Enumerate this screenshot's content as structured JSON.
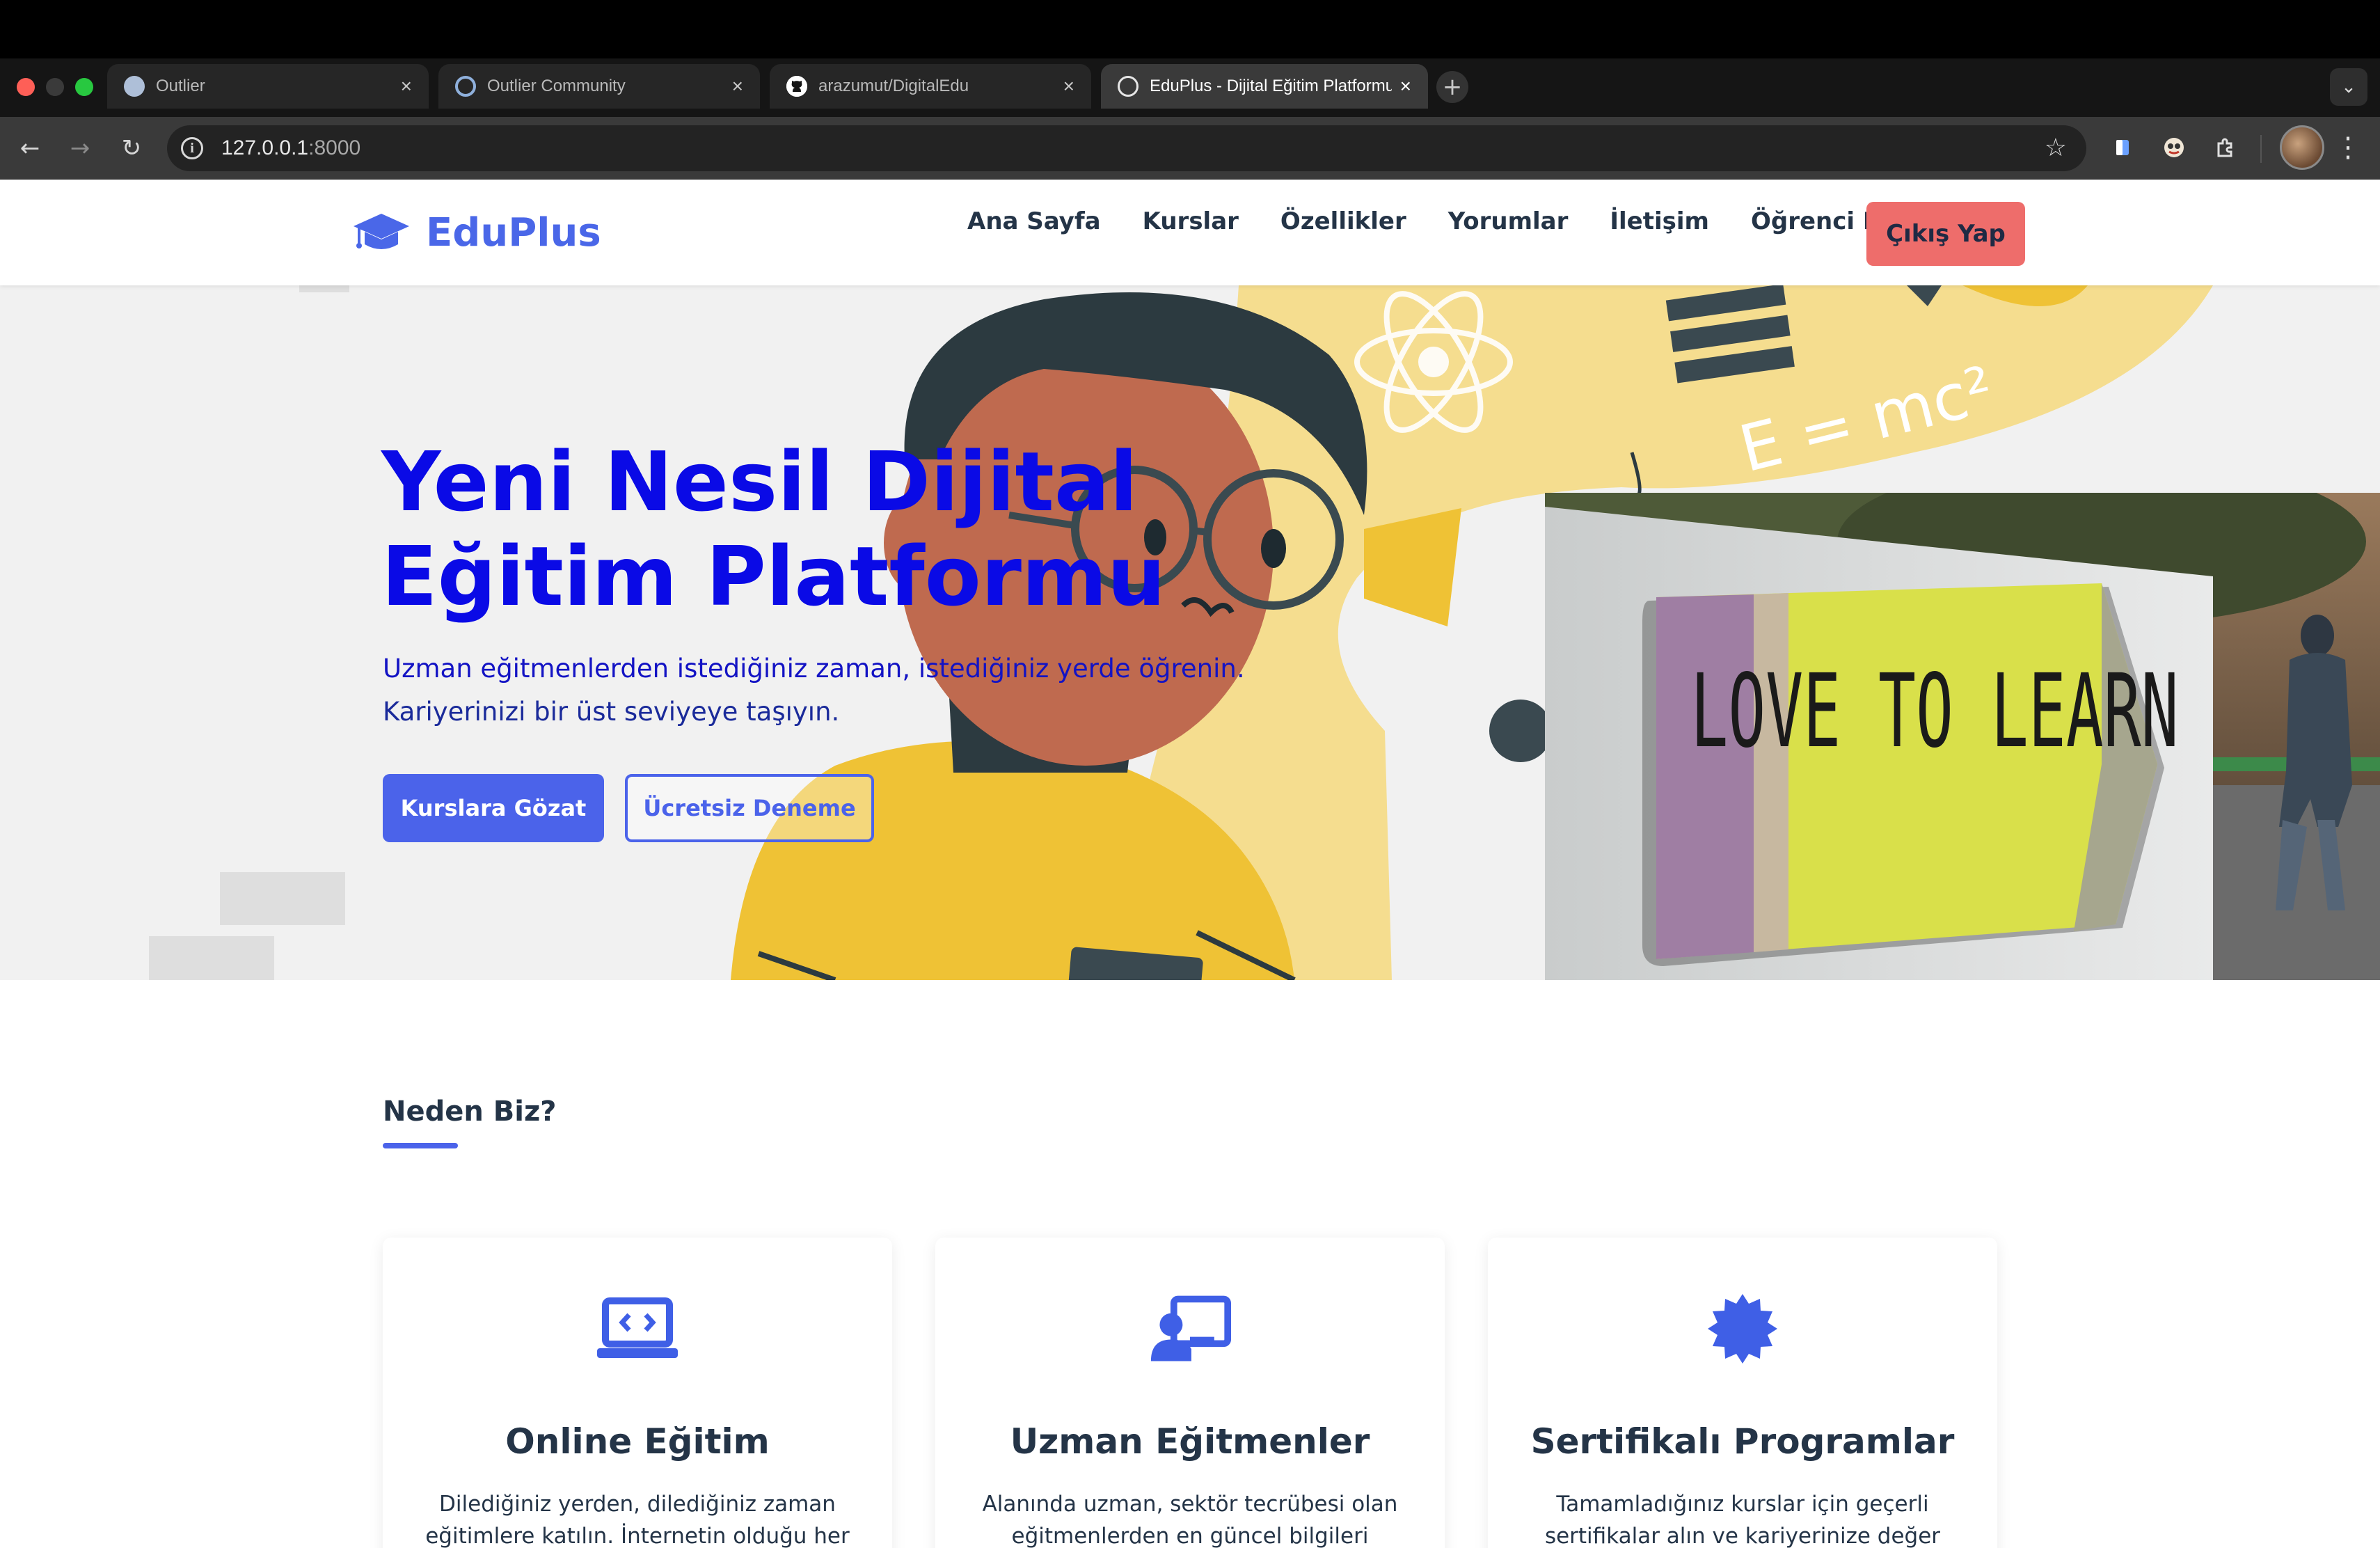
{
  "browser": {
    "tabs": [
      {
        "label": "Outlier",
        "favicon": "outlier-icon"
      },
      {
        "label": "Outlier Community",
        "favicon": "outlier-community-icon"
      },
      {
        "label": "arazumut/DigitalEdu",
        "favicon": "github-icon"
      },
      {
        "label": "EduPlus - Dijital Eğitim Platformu",
        "favicon": "globe-icon",
        "active": true
      }
    ],
    "url_host": "127.0.0.1",
    "url_port": ":8000"
  },
  "header": {
    "brand": "EduPlus",
    "nav": [
      "Ana Sayfa",
      "Kurslar",
      "Özellikler",
      "Yorumlar",
      "İletişim",
      "Öğrenci Paneli"
    ],
    "logout_label": "Çıkış Yap"
  },
  "hero": {
    "title_line1": "Yeni Nesil Dijital",
    "title_line2": "Eğitim Platformu",
    "subtitle_line1": "Uzman eğitmenlerden istediğiniz zaman, istediğiniz yerde öğrenin.",
    "subtitle_line2": "Kariyerinizi bir üst seviyeye taşıyın.",
    "primary_button": "Kurslara Gözat",
    "secondary_button": "Ücretsiz Deneme",
    "illustration_text": "E = mc²",
    "photo_sign_text": "LOVE TO LEARN"
  },
  "why": {
    "title": "Neden Biz?",
    "features": [
      {
        "title": "Online Eğitim",
        "text": "Dilediğiniz yerden, dilediğiniz zaman eğitimlere katılın. İnternetin olduğu her",
        "icon": "laptop-code-icon"
      },
      {
        "title": "Uzman Eğitmenler",
        "text": "Alanında uzman, sektör tecrübesi olan eğitmenlerden en güncel bilgileri öğrenin",
        "icon": "teacher-board-icon"
      },
      {
        "title": "Sertifikalı Programlar",
        "text": "Tamamladığınız kurslar için geçerli sertifikalar alın ve kariyerinize değer katın",
        "icon": "certificate-badge-icon"
      }
    ]
  },
  "colors": {
    "brand": "#4a67e8",
    "hero_title": "#0a0ae6",
    "logout": "#ee6d6b",
    "text_dark": "#243447"
  }
}
